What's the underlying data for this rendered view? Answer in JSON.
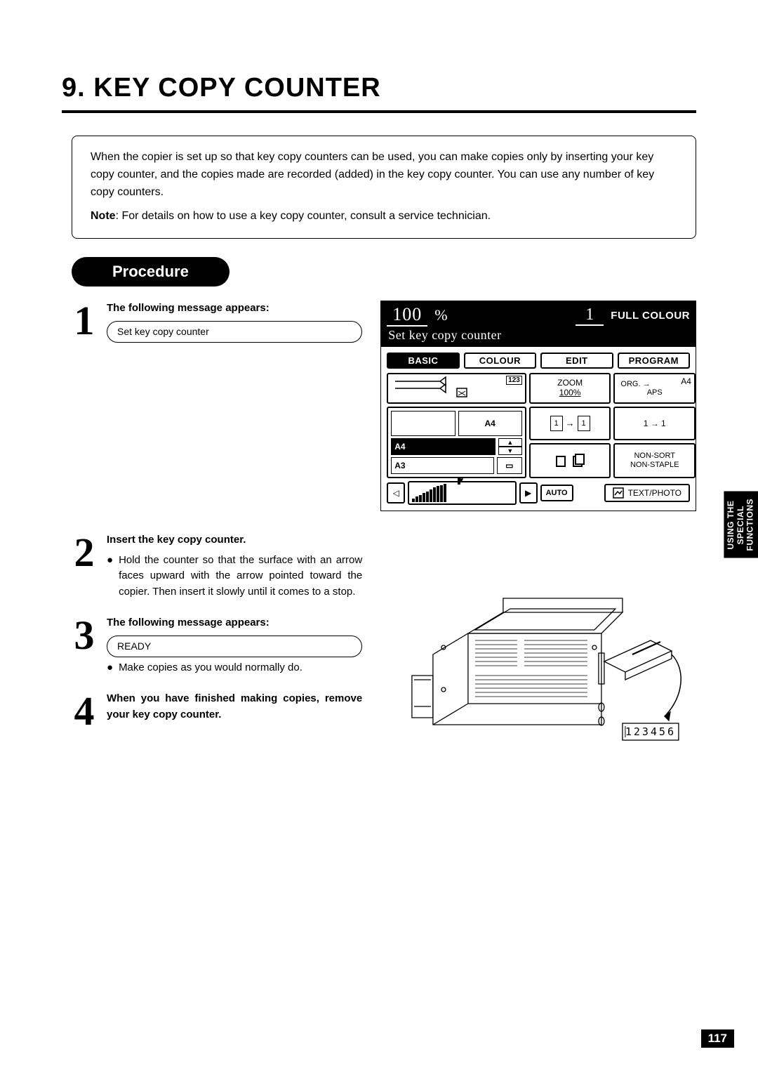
{
  "chapter": {
    "title": "9. KEY COPY COUNTER"
  },
  "intro": {
    "text": "When the copier is set up so that key copy counters can be used, you can make copies only by inserting your key copy counter, and the copies made are recorded (added) in the key copy counter. You can use any number of key copy counters.",
    "note_label": "Note",
    "note_text": ": For details on how to use a key copy counter, consult a service technician."
  },
  "procedure_label": "Procedure",
  "steps": {
    "s1": {
      "num": "1",
      "heading": "The following message appears:",
      "message": "Set key copy counter"
    },
    "s2": {
      "num": "2",
      "heading": "Insert the key copy counter.",
      "bullet": "Hold the counter so that the surface with an arrow faces upward with the arrow pointed toward the copier. Then insert it slowly until it comes to a stop."
    },
    "s3": {
      "num": "3",
      "heading": "The following message appears:",
      "message": "READY",
      "bullet": "Make copies as you would normally do."
    },
    "s4": {
      "num": "4",
      "heading": "When you have finished making copies, remove your key copy counter."
    }
  },
  "lcd": {
    "zoom_value": "100",
    "zoom_unit": "%",
    "quantity": "1",
    "colour_mode": "FULL COLOUR",
    "message": "Set key copy counter",
    "tabs": {
      "basic": "BASIC",
      "colour": "COLOUR",
      "edit": "EDIT",
      "program": "PROGRAM"
    },
    "tray_counter": "123",
    "zoom_label": "ZOOM",
    "zoom_pct": "100%",
    "org_label": "ORG.",
    "aps_label": "APS",
    "aps_size": "A4",
    "paper_a4": "A4",
    "paper_a4_big": "A4",
    "paper_a3": "A3",
    "duplex": "1 → 1",
    "sort": "NON-SORT",
    "staple": "NON-STAPLE",
    "auto": "AUTO",
    "image_type": "TEXT/PHOTO"
  },
  "counter_display": "123456",
  "side_tab": "USING THE\nSPECIAL\nFUNCTIONS",
  "page_number": "117"
}
